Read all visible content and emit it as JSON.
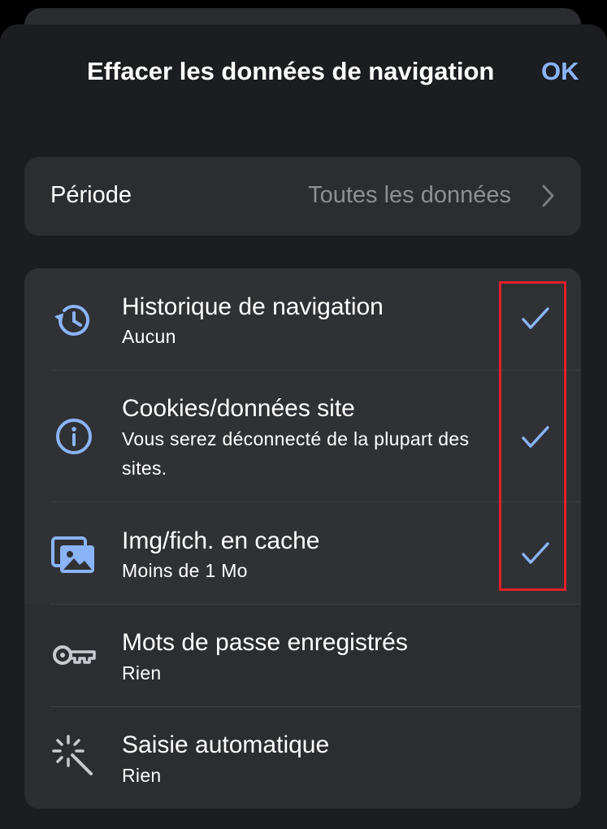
{
  "header": {
    "title": "Effacer les données de navigation",
    "ok_label": "OK"
  },
  "period": {
    "label": "Période",
    "value": "Toutes les données",
    "chevron_icon": "chevron-right-icon"
  },
  "items": [
    {
      "icon": "history-icon",
      "title": "Historique de navigation",
      "subtitle": "Aucun",
      "checked": true
    },
    {
      "icon": "info-icon",
      "title": "Cookies/données site",
      "subtitle": "Vous serez déconnecté de la plupart des sites.",
      "checked": true
    },
    {
      "icon": "images-icon",
      "title": "Img/fich. en cache",
      "subtitle": "Moins de 1 Mo",
      "checked": true
    },
    {
      "icon": "key-icon",
      "title": "Mots de passe enregistrés",
      "subtitle": "Rien",
      "checked": false
    },
    {
      "icon": "magic-wand-icon",
      "title": "Saisie automatique",
      "subtitle": "Rien",
      "checked": false
    }
  ],
  "colors": {
    "accent": "#8ab4f8",
    "background": "#1c1d21",
    "card": "#2c2d31",
    "highlight_box": "#e0202a"
  }
}
